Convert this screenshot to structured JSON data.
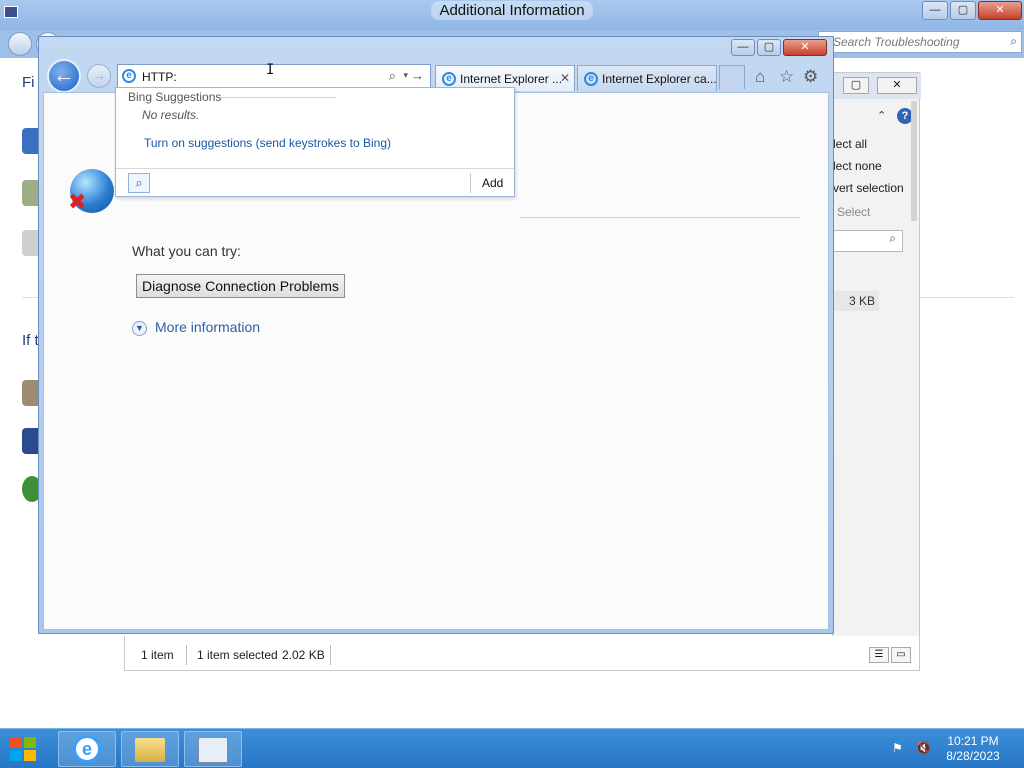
{
  "background_window": {
    "title": "Additional Information",
    "search_placeholder": "Search Troubleshooting",
    "left_texts": [
      "Fi",
      "If t"
    ],
    "window_controls": {
      "minimize": "—",
      "maximize": "▢",
      "close": "✕"
    }
  },
  "explorer_panel": {
    "select_all": "lect all",
    "select_none": "lect none",
    "invert_selection": "vert selection",
    "select_group": "Select",
    "file_size": "3 KB",
    "status_items": "1 item",
    "status_selected": "1 item selected",
    "status_size": "2.02 KB"
  },
  "ie": {
    "address_value": "HTTP:",
    "tabs": [
      {
        "label": "Internet Explorer ...",
        "active": true
      },
      {
        "label": "Internet Explorer ca...",
        "active": false
      }
    ],
    "content": {
      "partial_text": "What you can try:",
      "diagnose_button": "Diagnose Connection Problems",
      "more_information": "More information"
    },
    "suggestions": {
      "heading": "Bing Suggestions",
      "no_results": "No results.",
      "turn_on_link": "Turn on suggestions (send keystrokes to Bing)",
      "add_label": "Add"
    },
    "icons": {
      "back": "←",
      "forward": "→",
      "search": "⌕",
      "dropdown": "▾",
      "go": "→",
      "home": "⌂",
      "favorites": "☆",
      "tools": "⚙",
      "close_tab": "✕"
    }
  },
  "taskbar": {
    "time": "10:21 PM",
    "date": "8/28/2023"
  }
}
